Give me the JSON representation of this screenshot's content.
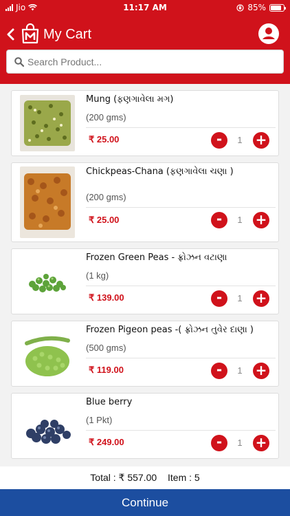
{
  "status_bar": {
    "carrier": "Jio",
    "time": "11:17 AM",
    "battery": "85%"
  },
  "header": {
    "title": "My Cart",
    "icons": [
      "back-icon",
      "logo-icon",
      "account-icon"
    ]
  },
  "search": {
    "placeholder": "Search Product..."
  },
  "items": [
    {
      "name": "Mung (ફણગાવેલા મગ)",
      "unit": "(200 gms)",
      "price": "₹ 25.00",
      "quantity": "1",
      "image": "sprouted-mung-tray",
      "minus": "-",
      "plus": "+"
    },
    {
      "name": "Chickpeas-Chana (ફણગાવેલા ચણા )",
      "unit": "(200 gms)",
      "price": "₹ 25.00",
      "quantity": "1",
      "image": "sprouted-chana-tray",
      "minus": "-",
      "plus": "+"
    },
    {
      "name": "Frozen Green Peas - ફ્રોઝન વટાણા",
      "unit": "(1 kg)",
      "price": "₹ 139.00",
      "quantity": "1",
      "image": "green-peas",
      "minus": "-",
      "plus": "+"
    },
    {
      "name": "Frozen Pigeon peas -( ફ્રોઝન તુવેર દાણા )",
      "unit": "(500 gms)",
      "price": "₹ 119.00",
      "quantity": "1",
      "image": "pigeon-peas",
      "minus": "-",
      "plus": "+"
    },
    {
      "name": "Blue berry",
      "unit": "(1 Pkt)",
      "price": "₹ 249.00",
      "quantity": "1",
      "image": "blueberries",
      "minus": "-",
      "plus": "+"
    }
  ],
  "summary": {
    "total": "Total : ₹ 557.00",
    "items": "Item : 5"
  },
  "footer": {
    "continue_label": "Continue"
  },
  "colors": {
    "brand_red": "#d0121b",
    "continue_blue": "#1c4ea0"
  }
}
